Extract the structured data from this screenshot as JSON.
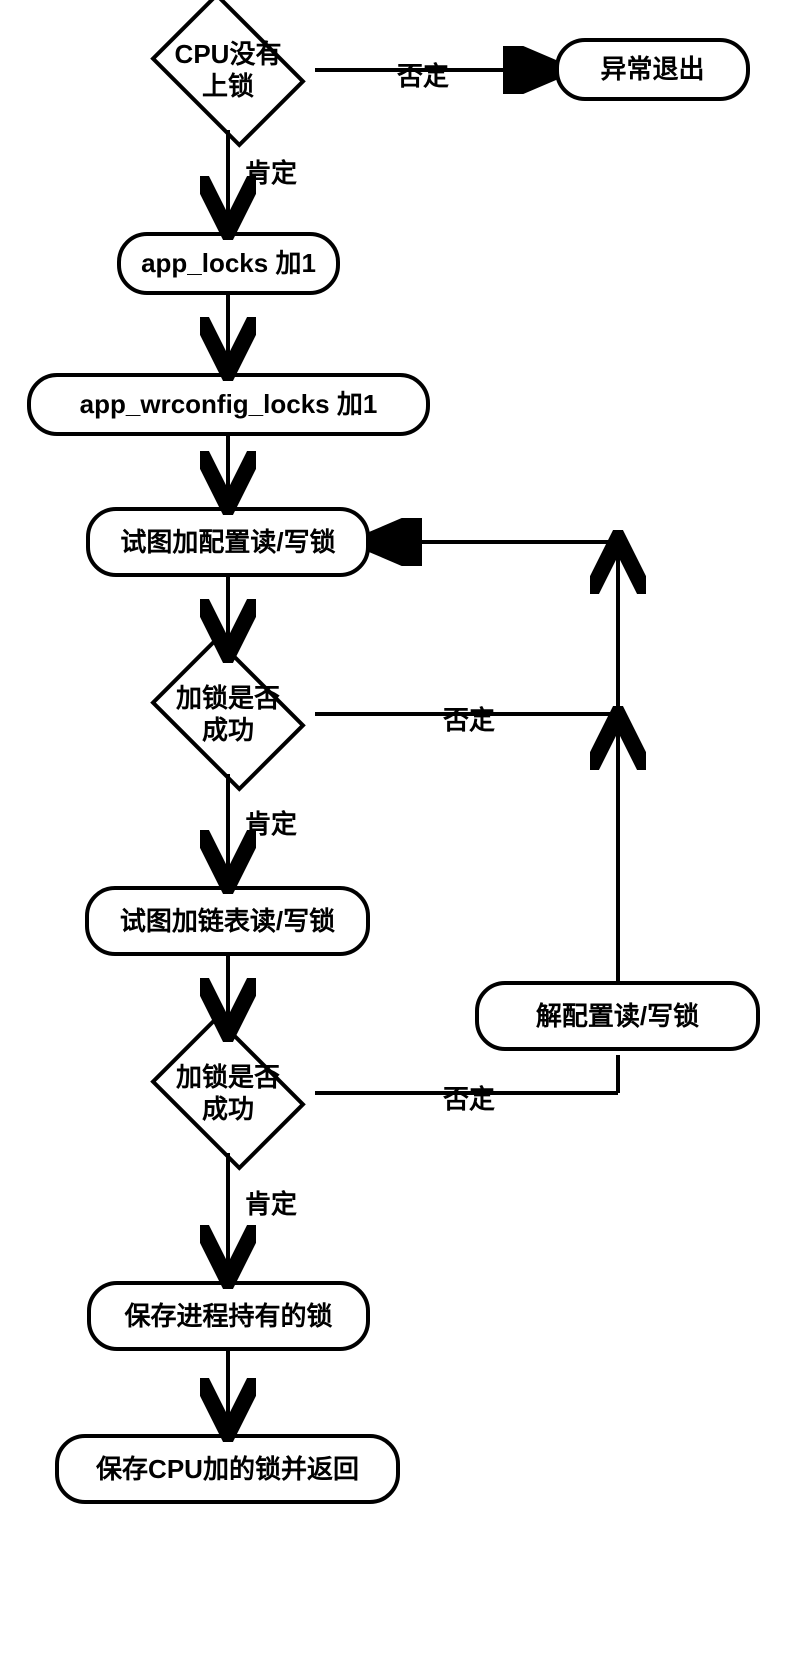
{
  "nodes": {
    "d1": "CPU没有\n上锁",
    "t1": "异常退出",
    "p1": "app_locks 加1",
    "p2": "app_wrconfig_locks 加1",
    "p3": "试图加配置读/写锁",
    "d2": "加锁是否\n成功",
    "p4": "试图加链表读/写锁",
    "p5": "解配置读/写锁",
    "d3": "加锁是否\n成功",
    "p6": "保存进程持有的锁",
    "p7": "保存CPU加的锁并返回"
  },
  "edges": {
    "yes": "肯定",
    "no": "否定"
  }
}
